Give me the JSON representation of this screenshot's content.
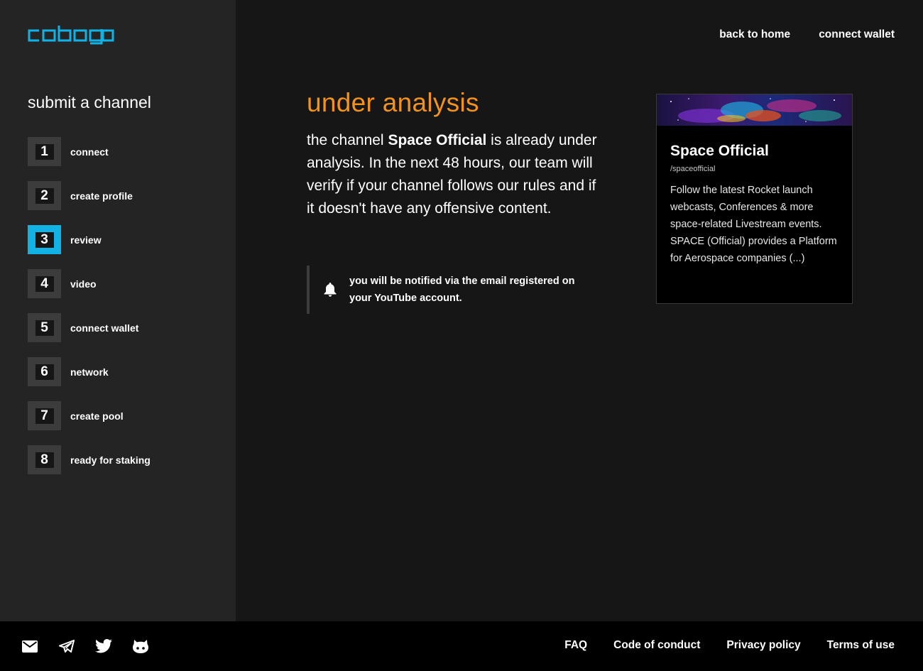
{
  "brand": {
    "logo_text": "cobogo",
    "accent_color": "#12b3e4"
  },
  "nav": {
    "back_home": "back to home",
    "connect_wallet": "connect wallet"
  },
  "sidebar": {
    "title": "submit a channel",
    "active_step": 3,
    "steps": [
      {
        "num": "1",
        "label": "connect"
      },
      {
        "num": "2",
        "label": "create profile"
      },
      {
        "num": "3",
        "label": "review"
      },
      {
        "num": "4",
        "label": "video"
      },
      {
        "num": "5",
        "label": "connect wallet"
      },
      {
        "num": "6",
        "label": "network"
      },
      {
        "num": "7",
        "label": "create pool"
      },
      {
        "num": "8",
        "label": "ready for staking"
      }
    ]
  },
  "main": {
    "title": "under analysis",
    "title_color": "#f3921d",
    "text_prefix": "the channel ",
    "channel_name": "Space Official",
    "text_suffix": " is already under analysis. In the next 48 hours, our team will verify if your channel follows our rules and if it doesn't have any offensive content."
  },
  "notice": {
    "icon": "bell-icon",
    "text": "you will be notified via the email registered on your YouTube account."
  },
  "card": {
    "title": "Space Official",
    "handle": "/spaceofficial",
    "description": "Follow the latest Rocket launch webcasts, Conferences & more space-related Livestream events. SPACE (Official) provides a Platform for Aerospace companies (...)"
  },
  "footer": {
    "social_icons": [
      "email-icon",
      "telegram-icon",
      "twitter-icon",
      "github-icon"
    ],
    "links": {
      "faq": "FAQ",
      "conduct": "Code of conduct",
      "privacy": "Privacy policy",
      "terms": "Terms of use"
    }
  }
}
